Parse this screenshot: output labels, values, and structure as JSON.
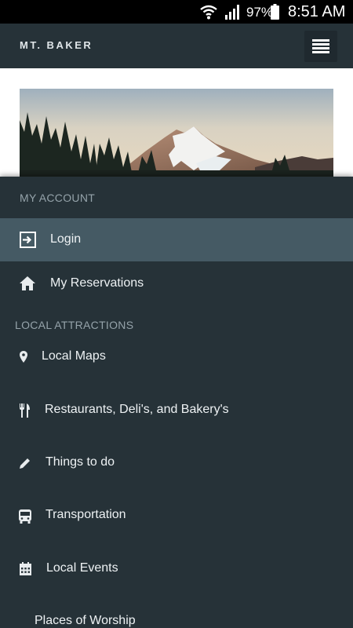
{
  "status_bar": {
    "battery": "97%",
    "time": "8:51 AM",
    "icons": [
      "wifi-icon",
      "signal-icon",
      "battery-icon"
    ]
  },
  "app_bar": {
    "title": "MT. BAKER",
    "menu_icon": "hamburger-menu-icon"
  },
  "hero_image": {
    "subject": "mountain-landscape"
  },
  "drawer": {
    "sections": [
      {
        "header": "MY ACCOUNT",
        "items": [
          {
            "label": "Login",
            "icon": "login-icon",
            "active": true
          },
          {
            "label": "My Reservations",
            "icon": "home-icon",
            "active": false
          }
        ]
      },
      {
        "header": "LOCAL ATTRACTIONS",
        "items": [
          {
            "label": "Local Maps",
            "icon": "map-pin-icon"
          },
          {
            "label": "Restaurants, Deli's, and Bakery's",
            "icon": "utensils-icon"
          },
          {
            "label": "Things to do",
            "icon": "pencil-icon"
          },
          {
            "label": "Transportation",
            "icon": "bus-icon"
          },
          {
            "label": "Local Events",
            "icon": "calendar-icon"
          },
          {
            "label": "Places of Worship",
            "icon": ""
          }
        ]
      }
    ]
  },
  "colors": {
    "drawer_bg": "#263238",
    "active_item_bg": "#455a64",
    "section_header": "#95a3aa",
    "status_bar": "#000000"
  }
}
